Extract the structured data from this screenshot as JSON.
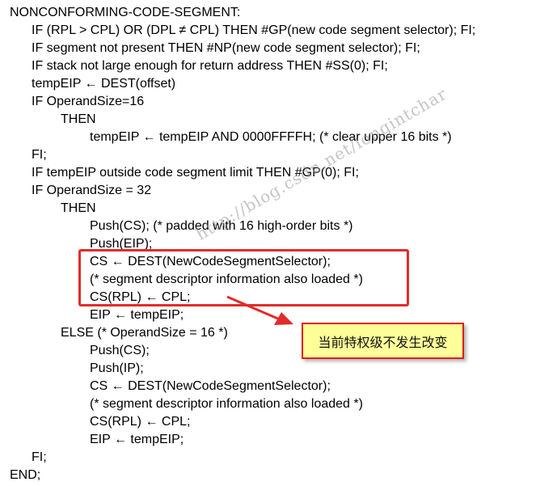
{
  "code_lines": [
    "NONCONFORMING-CODE-SEGMENT:",
    "IF (RPL > CPL) OR (DPL ≠ CPL) THEN #GP(new code segment selector); FI;",
    "IF segment not present THEN #NP(new code segment selector); FI;",
    "IF stack not large enough for return address THEN #SS(0); FI;",
    "tempEIP ← DEST(offset)",
    "IF OperandSize=16",
    "THEN",
    "tempEIP ← tempEIP AND 0000FFFFH; (* clear upper 16 bits *)",
    "FI;",
    "IF tempEIP outside code segment limit THEN #GP(0); FI;",
    "IF OperandSize = 32",
    "THEN",
    "Push(CS); (* padded with 16 high-order bits *)",
    "Push(EIP);",
    "CS ← DEST(NewCodeSegmentSelector);",
    "(* segment descriptor information also loaded *)",
    "CS(RPL) ← CPL;",
    "EIP ← tempEIP;",
    "ELSE (* OperandSize = 16 *)",
    "Push(CS);",
    "Push(IP);",
    "CS ← DEST(NewCodeSegmentSelector);",
    "(* segment descriptor information also loaded *)",
    "CS(RPL) ← CPL;",
    "EIP ← tempEIP;",
    "FI;",
    "END;"
  ],
  "callout_text": "当前特权级不发生改变",
  "watermark_text": "http://blog.csdn.net/longintchar",
  "colors": {
    "highlight_border": "#e32b2b",
    "callout_background": "#ffff9a",
    "arrow": "#e32b2b"
  }
}
